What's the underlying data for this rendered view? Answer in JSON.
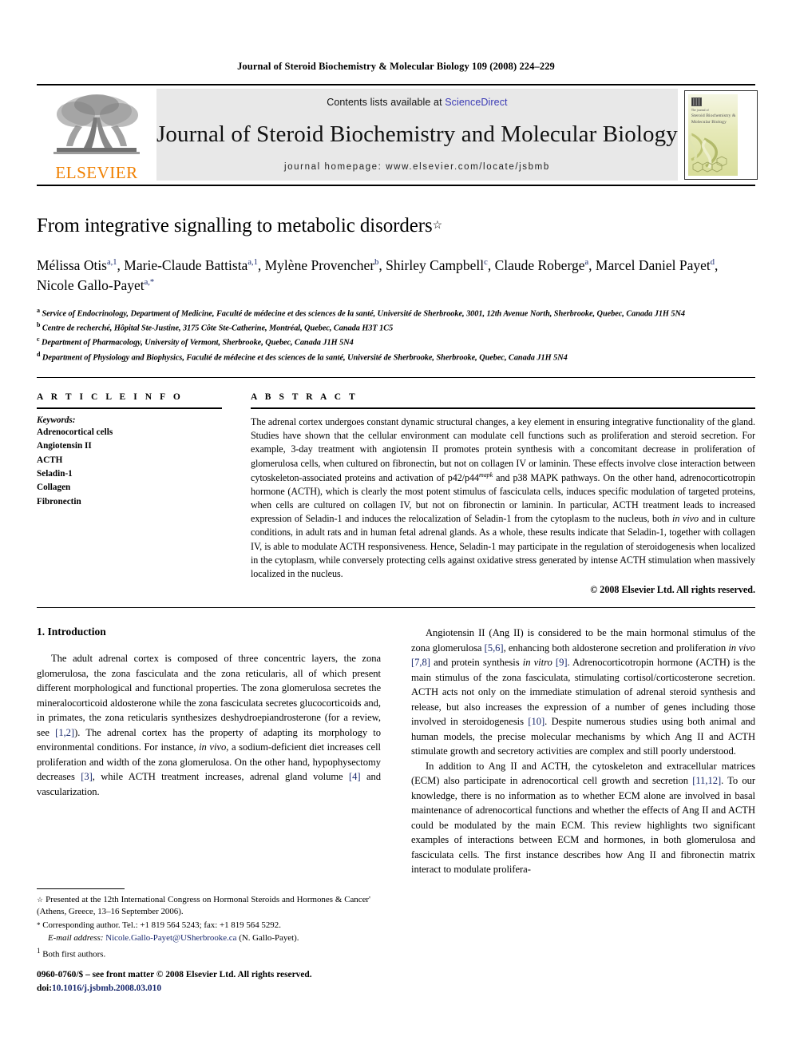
{
  "running_head": "Journal of Steroid Biochemistry & Molecular Biology 109 (2008) 224–229",
  "masthead": {
    "publisher_name": "ELSEVIER",
    "contents_prefix": "Contents lists available at ",
    "contents_link": "ScienceDirect",
    "journal_title": "Journal of Steroid Biochemistry and Molecular Biology",
    "homepage_line": "journal homepage: www.elsevier.com/locate/jsbmb",
    "cover_publisher_tiny": "The journal of",
    "cover_title_lines": "Steroid Biochemistry & Molecular Biology",
    "link_color": "#3b3bb5",
    "elsevier_orange": "#F08000"
  },
  "article": {
    "title": "From integrative signalling to metabolic disorders",
    "title_footnote_marker": "☆",
    "authors_line_1": "Mélissa Otis",
    "authors": [
      {
        "name": "Mélissa Otis",
        "sup": "a,1",
        "sep": ", "
      },
      {
        "name": "Marie-Claude Battista",
        "sup": "a,1",
        "sep": ", "
      },
      {
        "name": "Mylène Provencher",
        "sup": "b",
        "sep": ", "
      },
      {
        "name": "Shirley Campbell",
        "sup": "c",
        "sep": ", "
      },
      {
        "name": "Claude Roberge",
        "sup": "a",
        "sep": ", "
      },
      {
        "name": "Marcel Daniel Payet",
        "sup": "d",
        "sep": ", "
      },
      {
        "name": "Nicole Gallo-Payet",
        "sup": "a,*",
        "sep": ""
      }
    ],
    "affiliations": [
      {
        "marker": "a",
        "text": "Service of Endocrinology, Department of Medicine, Faculté de médecine et des sciences de la santé, Université de Sherbrooke, 3001, 12th Avenue North, Sherbrooke, Quebec, Canada J1H 5N4"
      },
      {
        "marker": "b",
        "text": "Centre de recherché, Hôpital Ste-Justine, 3175 Côte Ste-Catherine, Montréal, Quebec, Canada H3T 1C5"
      },
      {
        "marker": "c",
        "text": "Department of Pharmacology, University of Vermont, Sherbrooke, Quebec, Canada J1H 5N4"
      },
      {
        "marker": "d",
        "text": "Department of Physiology and Biophysics, Faculté de médecine et des sciences de la santé, Université de Sherbrooke, Sherbrooke, Quebec, Canada J1H 5N4"
      }
    ]
  },
  "article_info": {
    "label": "A R T I C L E  I N F O",
    "keywords_heading": "Keywords:",
    "keywords": [
      "Adrenocortical cells",
      "Angiotensin II",
      "ACTH",
      "Seladin-1",
      "Collagen",
      "Fibronectin"
    ]
  },
  "abstract": {
    "label": "A B S T R A C T",
    "part1": "The adrenal cortex undergoes constant dynamic structural changes, a key element in ensuring integrative functionality of the gland. Studies have shown that the cellular environment can modulate cell functions such as proliferation and steroid secretion. For example, 3-day treatment with angiotensin II promotes protein synthesis with a concomitant decrease in proliferation of glomerulosa cells, when cultured on fibronectin, but not on collagen IV or laminin. These effects involve close interaction between cytoskeleton-associated proteins and activation of p42/p44",
    "sup1": "mapk",
    "part2": " and p38 MAPK pathways. On the other hand, adrenocorticotropin hormone (ACTH), which is clearly the most potent stimulus of fasciculata cells, induces specific modulation of targeted proteins, when cells are cultured on collagen IV, but not on fibronectin or laminin. In particular, ACTH treatment leads to increased expression of Seladin-1 and induces the relocalization of Seladin-1 from the cytoplasm to the nucleus, both ",
    "italic1": "in vivo",
    "part3": " and in culture conditions, in adult rats and in human fetal adrenal glands. As a whole, these results indicate that Seladin-1, together with collagen IV, is able to modulate ACTH responsiveness. Hence, Seladin-1 may participate in the regulation of steroidogenesis when localized in the cytoplasm, while conversely protecting cells against oxidative stress generated by intense ACTH stimulation when massively localized in the nucleus.",
    "copyright": "© 2008 Elsevier Ltd. All rights reserved."
  },
  "body": {
    "section_heading": "1. Introduction",
    "left_para_1_a": "The adult adrenal cortex is composed of three concentric layers, the zona glomerulosa, the zona fasciculata and the zona reticularis, all of which present different morphological and functional properties. The zona glomerulosa secretes the mineralocorticoid aldosterone while the zona fasciculata secretes glucocorticoids and, in primates, the zona reticularis synthesizes deshydroepiandrosterone (for a review, see ",
    "left_ref_1": "[1,2]",
    "left_para_1_b": "). The adrenal cortex has the property of adapting its morphology to environmental conditions. For instance, ",
    "left_italic_1": "in vivo",
    "left_para_1_c": ", a sodium-deficient diet increases cell proliferation and width of the zona glomerulosa. On the other hand, hypophysectomy decreases ",
    "left_ref_2": "[3]",
    "left_para_1_d": ", while ACTH treatment increases, adrenal gland volume ",
    "left_ref_3": "[4]",
    "left_para_1_e": " and vascularization.",
    "right_para_1_a": "Angiotensin II (Ang II) is considered to be the main hormonal stimulus of the zona glomerulosa ",
    "right_ref_1": "[5,6]",
    "right_para_1_b": ", enhancing both aldosterone secretion and proliferation ",
    "right_italic_1": "in vivo",
    "right_para_1_c": " ",
    "right_ref_2": "[7,8]",
    "right_para_1_d": " and protein synthesis ",
    "right_italic_2": "in vitro",
    "right_para_1_e": " ",
    "right_ref_3": "[9]",
    "right_para_1_f": ". Adrenocorticotropin hormone (ACTH) is the main stimulus of the zona fasciculata, stimulating cortisol/corticosterone secretion. ACTH acts not only on the immediate stimulation of adrenal steroid synthesis and release, but also increases the expression of a number of genes including those involved in steroidogenesis ",
    "right_ref_4": "[10]",
    "right_para_1_g": ". Despite numerous studies using both animal and human models, the precise molecular mechanisms by which Ang II and ACTH stimulate growth and secretory activities are complex and still poorly understood.",
    "right_para_2_a": "In addition to Ang II and ACTH, the cytoskeleton and extracellular matrices (ECM) also participate in adrenocortical cell growth and secretion ",
    "right_ref_5": "[11,12]",
    "right_para_2_b": ". To our knowledge, there is no information as to whether ECM alone are involved in basal maintenance of adrenocortical functions and whether the effects of Ang II and ACTH could be modulated by the main ECM. This review highlights two significant examples of interactions between ECM and hormones, in both glomerulosa and fasciculata cells. The first instance describes how Ang II and fibronectin matrix interact to modulate prolifera-"
  },
  "footnotes": {
    "star_marker": "☆",
    "star_text": " Presented at the 12th International Congress on Hormonal Steroids and Hormones & Cancer' (Athens, Greece, 13–16 September 2006).",
    "corresponding_marker": "*",
    "corresponding_text": " Corresponding author. Tel.: +1 819 564 5243; fax: +1 819 564 5292.",
    "email_label": "E-mail address:",
    "email": "Nicole.Gallo-Payet@USherbrooke.ca",
    "email_suffix": " (N. Gallo-Payet).",
    "one_marker": "1",
    "one_text": " Both first authors.",
    "imprint_line_1": "0960-0760/$ – see front matter © 2008 Elsevier Ltd. All rights reserved.",
    "imprint_doi_label": "doi:",
    "imprint_doi": "10.1016/j.jsbmb.2008.03.010"
  }
}
